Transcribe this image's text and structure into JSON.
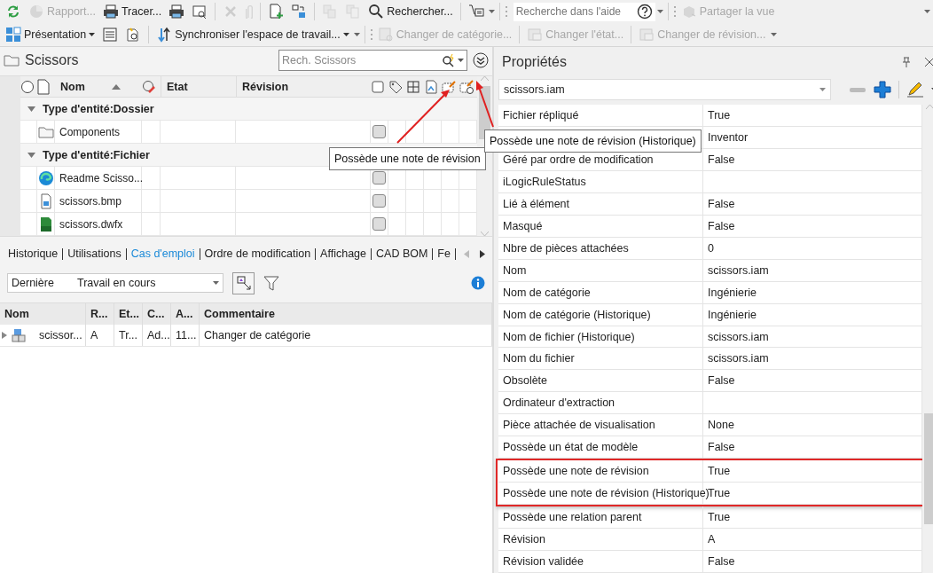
{
  "toolbar_rows": [
    [
      {
        "kind": "button",
        "disabled": false
      },
      {
        "kind": "button",
        "label": "Rapport...",
        "disabled": true
      },
      {
        "kind": "button",
        "label": "Tracer...",
        "disabled": false
      },
      {
        "kind": "button",
        "disabled": false
      },
      {
        "kind": "button",
        "disabled": false
      },
      {
        "kind": "separator"
      },
      {
        "kind": "button",
        "disabled": true
      },
      {
        "kind": "button",
        "disabled": true
      },
      {
        "kind": "separator"
      },
      {
        "kind": "button",
        "disabled": false
      },
      {
        "kind": "button",
        "disabled": false
      },
      {
        "kind": "separator"
      },
      {
        "kind": "button",
        "disabled": true
      },
      {
        "kind": "button",
        "disabled": true
      },
      {
        "kind": "button",
        "label": "Rechercher...",
        "disabled": false
      },
      {
        "kind": "separator"
      },
      {
        "kind": "button",
        "disabled": false
      },
      {
        "kind": "caret"
      },
      {
        "kind": "separator"
      },
      {
        "kind": "grip"
      },
      {
        "kind": "search",
        "placeholder": "Recherche dans l'aide"
      },
      {
        "kind": "caret"
      },
      {
        "kind": "separator"
      },
      {
        "kind": "grip"
      },
      {
        "kind": "button",
        "label": "Partager la vue",
        "disabled": true
      },
      {
        "kind": "spacer"
      },
      {
        "kind": "caret"
      }
    ],
    [
      {
        "kind": "button",
        "label": "Présentation",
        "menu": true,
        "disabled": false
      },
      {
        "kind": "button",
        "disabled": false
      },
      {
        "kind": "button",
        "disabled": false
      },
      {
        "kind": "separator"
      },
      {
        "kind": "button",
        "label": "Synchroniser l'espace de travail...",
        "menu": true,
        "disabled": false
      },
      {
        "kind": "caret"
      },
      {
        "kind": "separator"
      },
      {
        "kind": "grip"
      },
      {
        "kind": "button",
        "label": "Changer de catégorie...",
        "disabled": true
      },
      {
        "kind": "separator"
      },
      {
        "kind": "button",
        "label": "Changer l'état...",
        "disabled": true
      },
      {
        "kind": "separator"
      },
      {
        "kind": "button",
        "label": "Changer de révision...",
        "disabled": true
      },
      {
        "kind": "caret"
      }
    ]
  ],
  "explorer": {
    "title": "Scissors",
    "search": {
      "placeholder": "Rech. Scissors"
    },
    "columns": [
      "Nom",
      "Etat",
      "Révision"
    ],
    "groups": [
      {
        "label": "Type d'entité:Dossier",
        "expanded": true,
        "rows": [
          {
            "kind": "folder",
            "name": "Components",
            "checked": false
          }
        ]
      },
      {
        "label": "Type d'entité:Fichier",
        "expanded": true,
        "rows": [
          {
            "kind": "browser",
            "name": "Readme Scisso...",
            "checked": false
          },
          {
            "kind": "image",
            "name": "scissors.bmp",
            "checked": false
          },
          {
            "kind": "dwf",
            "name": "scissors.dwfx",
            "checked": false
          }
        ]
      }
    ],
    "tooltips": [
      "Possède une note de révision",
      "Possède une note de révision (Historique)"
    ]
  },
  "detail_tabs": [
    {
      "label": "Historique",
      "selected": false
    },
    {
      "label": "Utilisations",
      "selected": false
    },
    {
      "label": "Cas d'emploi",
      "selected": true
    },
    {
      "label": "Ordre de modification",
      "selected": false
    },
    {
      "label": "Affichage",
      "selected": false
    },
    {
      "label": "CAD BOM",
      "selected": false
    },
    {
      "label": "Fe",
      "selected": false
    }
  ],
  "version_filter": {
    "version": "Dernière",
    "state": "Travail en cours"
  },
  "uses_table": {
    "columns": [
      "Nom",
      "R...",
      "Et...",
      "C...",
      "A...",
      "Commentaire"
    ],
    "rows": [
      {
        "expanded": false,
        "cells": [
          "scissor...",
          "A",
          "Tr...",
          "Ad...",
          "11...",
          "Changer de catégorie"
        ]
      }
    ]
  },
  "properties": {
    "title": "Propriétés",
    "object": "scissors.iam",
    "rows": [
      {
        "name": "Fichier répliqué",
        "value": "True",
        "highlighted": false
      },
      {
        "value": "Inventor",
        "highlighted": false
      },
      {
        "name": "Géré par ordre de modification",
        "value": "False",
        "highlighted": false
      },
      {
        "name": "iLogicRuleStatus",
        "highlighted": false
      },
      {
        "name": "Lié à élément",
        "value": "False",
        "highlighted": false
      },
      {
        "name": "Masqué",
        "value": "False",
        "highlighted": false
      },
      {
        "name": "Nbre de pièces attachées",
        "value": "0",
        "highlighted": false
      },
      {
        "name": "Nom",
        "value": "scissors.iam",
        "highlighted": false
      },
      {
        "name": "Nom de catégorie",
        "value": "Ingénierie",
        "highlighted": false
      },
      {
        "name": "Nom de catégorie (Historique)",
        "value": "Ingénierie",
        "highlighted": false
      },
      {
        "name": "Nom de fichier (Historique)",
        "value": "scissors.iam",
        "highlighted": false
      },
      {
        "name": "Nom du fichier",
        "value": "scissors.iam",
        "highlighted": false
      },
      {
        "name": "Obsolète",
        "value": "False",
        "highlighted": false
      },
      {
        "name": "Ordinateur d'extraction",
        "highlighted": false
      },
      {
        "name": "Pièce attachée de visualisation",
        "value": "None",
        "highlighted": false
      },
      {
        "name": "Possède un état de modèle",
        "value": "False",
        "highlighted": false
      },
      {
        "name": "Possède une note de révision",
        "value": "True",
        "highlighted": true
      },
      {
        "name": "Possède une note de révision (Historique)",
        "value": "True",
        "highlighted": true
      },
      {
        "name": "Possède une relation parent",
        "value": "True",
        "highlighted": false
      },
      {
        "name": "Révision",
        "value": "A",
        "highlighted": false
      },
      {
        "name": "Révision validée",
        "value": "False",
        "highlighted": false
      }
    ]
  }
}
